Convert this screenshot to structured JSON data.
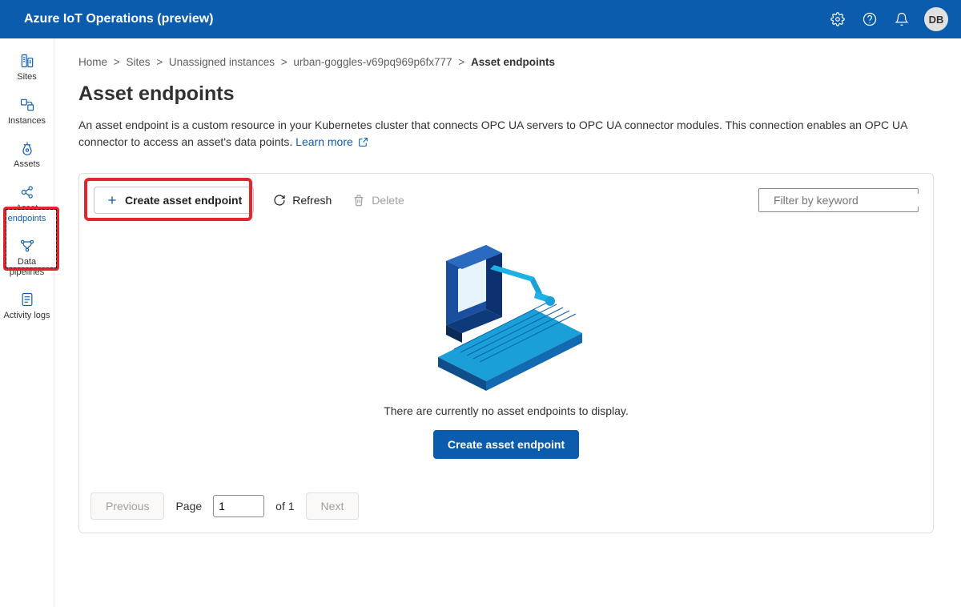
{
  "header": {
    "title": "Azure IoT Operations (preview)",
    "avatar_initials": "DB"
  },
  "leftnav": {
    "items": [
      {
        "label": "Sites"
      },
      {
        "label": "Instances"
      },
      {
        "label": "Assets"
      },
      {
        "label": "Asset endpoints"
      },
      {
        "label": "Data pipelines"
      },
      {
        "label": "Activity logs"
      }
    ]
  },
  "breadcrumb": {
    "items": [
      {
        "label": "Home"
      },
      {
        "label": "Sites"
      },
      {
        "label": "Unassigned instances"
      },
      {
        "label": "urban-goggles-v69pq969p6fx777"
      }
    ],
    "current": "Asset endpoints"
  },
  "page": {
    "title": "Asset endpoints",
    "description": "An asset endpoint is a custom resource in your Kubernetes cluster that connects OPC UA servers to OPC UA connector modules. This connection enables an OPC UA connector to access an asset's data points. ",
    "learn_more": "Learn more"
  },
  "toolbar": {
    "create_label": "Create asset endpoint",
    "refresh_label": "Refresh",
    "delete_label": "Delete",
    "search_placeholder": "Filter by keyword"
  },
  "empty_state": {
    "message": "There are currently no asset endpoints to display.",
    "cta_label": "Create asset endpoint"
  },
  "pager": {
    "previous_label": "Previous",
    "next_label": "Next",
    "page_word": "Page",
    "current_page": "1",
    "of_word": "of",
    "total_pages": "1"
  }
}
